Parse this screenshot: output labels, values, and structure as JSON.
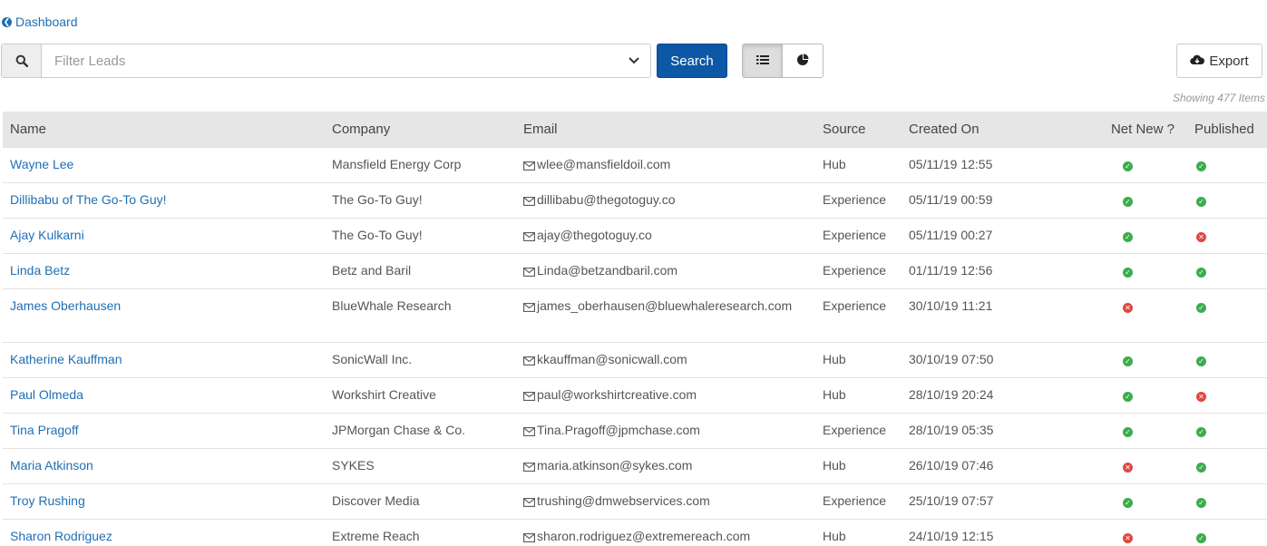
{
  "nav": {
    "back_label": "Dashboard"
  },
  "search": {
    "placeholder": "Filter Leads",
    "value": "",
    "button_label": "Search"
  },
  "toolbar": {
    "export_label": "Export",
    "view_modes": [
      "list",
      "chart"
    ],
    "active_view": "list"
  },
  "summary": {
    "showing_text": "Showing 477 Items"
  },
  "colors": {
    "link": "#1f6fb5",
    "primary": "#0d58a6",
    "ok": "#3cac4c",
    "bad": "#e0473f",
    "header_bg": "#e6e6e6"
  },
  "table": {
    "headers": [
      "Name",
      "Company",
      "Email",
      "Source",
      "Created On",
      "Net New ?",
      "Published"
    ],
    "rows": [
      {
        "name": "Wayne Lee",
        "company": "Mansfield Energy Corp",
        "email": "wlee@mansfieldoil.com",
        "source": "Hub",
        "created": "05/11/19 12:55",
        "net_new": "yes",
        "published": "yes"
      },
      {
        "name": "Dillibabu of The Go-To Guy!",
        "company": "The Go-To Guy!",
        "email": "dillibabu@thegotoguy.co",
        "source": "Experience",
        "created": "05/11/19 00:59",
        "net_new": "yes",
        "published": "yes"
      },
      {
        "name": "Ajay Kulkarni",
        "company": "The Go-To Guy!",
        "email": "ajay@thegotoguy.co",
        "source": "Experience",
        "created": "05/11/19 00:27",
        "net_new": "yes",
        "published": "no"
      },
      {
        "name": "Linda Betz",
        "company": "Betz and Baril",
        "email": "Linda@betzandbaril.com",
        "source": "Experience",
        "created": "01/11/19 12:56",
        "net_new": "yes",
        "published": "yes"
      },
      {
        "name": "James Oberhausen",
        "company": "BlueWhale Research",
        "email": "james_oberhausen@bluewhaleresearch.com",
        "source": "Experience",
        "created": "30/10/19 11:21",
        "net_new": "no",
        "published": "yes"
      },
      {
        "name": "Katherine Kauffman",
        "company": "SonicWall Inc.",
        "email": "kkauffman@sonicwall.com",
        "source": "Hub",
        "created": "30/10/19 07:50",
        "net_new": "yes",
        "published": "yes"
      },
      {
        "name": "Paul Olmeda",
        "company": "Workshirt Creative",
        "email": "paul@workshirtcreative.com",
        "source": "Hub",
        "created": "28/10/19 20:24",
        "net_new": "yes",
        "published": "no"
      },
      {
        "name": "Tina Pragoff",
        "company": "JPMorgan Chase & Co.",
        "email": "Tina.Pragoff@jpmchase.com",
        "source": "Experience",
        "created": "28/10/19 05:35",
        "net_new": "yes",
        "published": "yes"
      },
      {
        "name": "Maria Atkinson",
        "company": "SYKES",
        "email": "maria.atkinson@sykes.com",
        "source": "Hub",
        "created": "26/10/19 07:46",
        "net_new": "no",
        "published": "yes"
      },
      {
        "name": "Troy Rushing",
        "company": "Discover Media",
        "email": "trushing@dmwebservices.com",
        "source": "Experience",
        "created": "25/10/19 07:57",
        "net_new": "yes",
        "published": "yes"
      },
      {
        "name": "Sharon Rodriguez",
        "company": "Extreme Reach",
        "email": "sharon.rodriguez@extremereach.com",
        "source": "Hub",
        "created": "24/10/19 12:15",
        "net_new": "no",
        "published": "yes"
      }
    ]
  }
}
